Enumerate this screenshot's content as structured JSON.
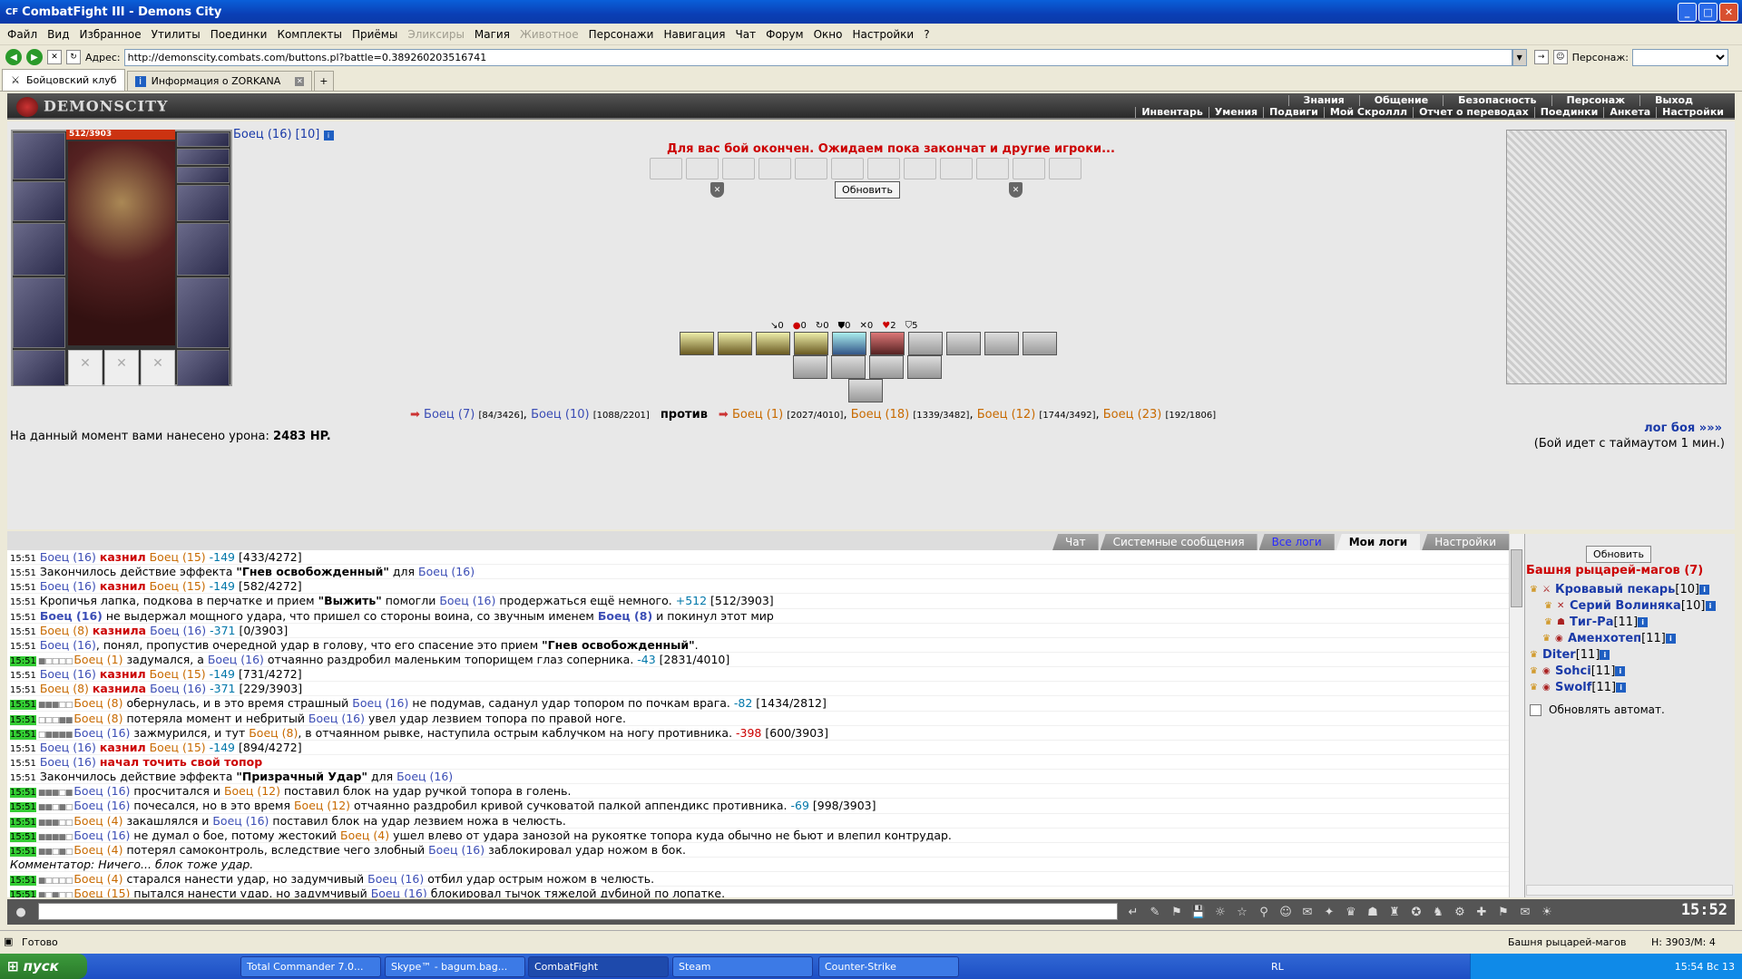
{
  "window": {
    "title": "CombatFight III - Demons City",
    "logo": "CF"
  },
  "menu": [
    {
      "label": "Файл",
      "enabled": true
    },
    {
      "label": "Вид",
      "enabled": true
    },
    {
      "label": "Избранное",
      "enabled": true
    },
    {
      "label": "Утилиты",
      "enabled": true
    },
    {
      "label": "Поединки",
      "enabled": true
    },
    {
      "label": "Комплекты",
      "enabled": true
    },
    {
      "label": "Приёмы",
      "enabled": true
    },
    {
      "label": "Эликсиры",
      "enabled": false
    },
    {
      "label": "Магия",
      "enabled": true
    },
    {
      "label": "Животное",
      "enabled": false
    },
    {
      "label": "Персонажи",
      "enabled": true
    },
    {
      "label": "Навигация",
      "enabled": true
    },
    {
      "label": "Чат",
      "enabled": true
    },
    {
      "label": "Форум",
      "enabled": true
    },
    {
      "label": "Окно",
      "enabled": true
    },
    {
      "label": "Настройки",
      "enabled": true
    },
    {
      "label": "?",
      "enabled": true
    }
  ],
  "address": {
    "label": "Адрес:",
    "url": "http://demonscity.combats.com/buttons.pl?battle=0.389260203516741",
    "persona_label": "Персонаж:"
  },
  "browser_tabs": [
    {
      "label": "Бойцовский клуб",
      "active": true
    },
    {
      "label": "Информация о ZORKANA",
      "active": false
    }
  ],
  "game": {
    "logo": "DEMONSCITY",
    "nav_top": [
      "Знания",
      "Общение",
      "Безопасность",
      "Персонаж",
      "Выход"
    ],
    "nav_bottom": [
      "Инвентарь",
      "Умения",
      "Подвиги",
      "Мой Скроллл",
      "Отчет о переводах",
      "Поединки",
      "Анкета",
      "Настройки"
    ],
    "hp": "512/3903",
    "player_name": "Боец (16) [10]",
    "status_message": "Для вас бой окончен. Ожидаем пока закончат и другие игроки...",
    "refresh_label": "Обновить",
    "counters": [
      "0",
      "0",
      "0",
      "0",
      "0",
      "2",
      "5"
    ],
    "team1": [
      {
        "name": "Боец (7)",
        "hp": "[84/3426]"
      },
      {
        "name": "Боец (10)",
        "hp": "[1088/2201]"
      }
    ],
    "vs": "против",
    "team2": [
      {
        "name": "Боец (1)",
        "hp": "[2027/4010]"
      },
      {
        "name": "Боец (18)",
        "hp": "[1339/3482]"
      },
      {
        "name": "Боец (12)",
        "hp": "[1744/3492]"
      },
      {
        "name": "Боец (23)",
        "hp": "[192/1806]"
      }
    ],
    "damage_label": "На данный момент вами нанесено урона:",
    "damage_value": "2483 HP.",
    "log_link": "лог боя »»»",
    "timeout": "(Бой идет с таймаутом 1 мин.)"
  },
  "log_tabs": [
    "Чат",
    "Системные сообщения",
    "Все логи",
    "Мои логи",
    "Настройки"
  ],
  "log": [
    {
      "time": "15:51",
      "g": false,
      "html": "<span class='link-blue'>Боец (16)</span> <span class='red'>казнил</span> <span class='link-orange'>Боец (15)</span> <span class='neg'>-149</span> [433/4272]"
    },
    {
      "time": "15:51",
      "g": false,
      "html": "Закончилось действие эффекта <b>\"Гнев освобожденный\"</b> для <span class='link-blue'>Боец (16)</span>"
    },
    {
      "time": "15:51",
      "g": false,
      "html": "<span class='link-blue'>Боец (16)</span> <span class='red'>казнил</span> <span class='link-orange'>Боец (15)</span> <span class='neg'>-149</span> [582/4272]"
    },
    {
      "time": "15:51",
      "g": false,
      "html": "Кропичья лапка, подкова в перчатке и прием <b>\"Выжить\"</b> помогли <span class='link-blue'>Боец (16)</span> продержаться ещё немного. <span class='neg'>+512</span> [512/3903]"
    },
    {
      "time": "15:51",
      "g": false,
      "html": "<b class='link-blue'>Боец (16)</b> не выдержал мощного удара, что пришел со стороны воина, со звучным именем <b class='link-blue'>Боец (8)</b> и покинул этот мир"
    },
    {
      "time": "15:51",
      "g": false,
      "html": "<span class='link-orange'>Боец (8)</span> <span class='red'>казнила</span> <span class='link-blue'>Боец (16)</span> <span class='neg'>-371</span> [0/3903]"
    },
    {
      "time": "15:51",
      "g": false,
      "html": "<span class='link-blue'>Боец (16)</span>, понял, пропустив очередной удар в голову, что его спасение это прием <b>\"Гнев освобожденный\"</b>."
    },
    {
      "time": "15:51",
      "g": true,
      "box": "■□□□□",
      "html": "<span class='link-orange'>Боец (1)</span> задумался, а <span class='link-blue'>Боец (16)</span> отчаянно раздробил маленьким топорищем глаз соперника. <span class='neg'>-43</span> [2831/4010]"
    },
    {
      "time": "15:51",
      "g": false,
      "html": "<span class='link-blue'>Боец (16)</span> <span class='red'>казнил</span> <span class='link-orange'>Боец (15)</span> <span class='neg'>-149</span> [731/4272]"
    },
    {
      "time": "15:51",
      "g": false,
      "html": "<span class='link-orange'>Боец (8)</span> <span class='red'>казнила</span> <span class='link-blue'>Боец (16)</span> <span class='neg'>-371</span> [229/3903]"
    },
    {
      "time": "15:51",
      "g": true,
      "box": "■■■□□",
      "html": "<span class='link-orange'>Боец (8)</span> обернулась, и в это время страшный <span class='link-blue'>Боец (16)</span> не подумав, саданул удар топором по почкам врага. <span class='neg'>-82</span> [1434/2812]"
    },
    {
      "time": "15:51",
      "g": true,
      "box": "□□□■■",
      "html": "<span class='link-orange'>Боец (8)</span> потеряла момент и небритый <span class='link-blue'>Боец (16)</span> увел удар лезвием топора по правой ноге."
    },
    {
      "time": "15:51",
      "g": true,
      "box": "□■■■■",
      "html": "<span class='link-blue'>Боец (16)</span> зажмурился, и тут <span class='link-orange'>Боец (8)</span>, в отчаянном рывке, наступила острым каблучком на ногу противника. <span class='hred'>-398</span> [600/3903]"
    },
    {
      "time": "15:51",
      "g": false,
      "html": "<span class='link-blue'>Боец (16)</span> <span class='red'>казнил</span> <span class='link-orange'>Боец (15)</span> <span class='neg'>-149</span> [894/4272]"
    },
    {
      "time": "15:51",
      "g": false,
      "html": "<span class='link-blue'>Боец (16)</span> <span class='red'>начал точить свой топор</span>"
    },
    {
      "time": "15:51",
      "g": false,
      "html": "Закончилось действие эффекта <b>\"Призрачный Удар\"</b> для <span class='link-blue'>Боец (16)</span>"
    },
    {
      "time": "15:51",
      "g": true,
      "box": "■■■□■",
      "html": "<span class='link-blue'>Боец (16)</span> просчитался и <span class='link-orange'>Боец (12)</span> поставил блок на удар ручкой топора в голень."
    },
    {
      "time": "15:51",
      "g": true,
      "box": "■■□■□",
      "html": "<span class='link-blue'>Боец (16)</span> почесался, но в это время <span class='link-orange'>Боец (12)</span> отчаянно раздробил кривой сучковатой палкой аппендикс противника. <span class='neg'>-69</span> [998/3903]"
    },
    {
      "time": "15:51",
      "g": true,
      "box": "■■■□□",
      "html": "<span class='link-orange'>Боец (4)</span> закашлялся и <span class='link-blue'>Боец (16)</span> поставил блок на удар лезвием ножа в челюсть."
    },
    {
      "time": "15:51",
      "g": true,
      "box": "■■■■□",
      "html": "<span class='link-blue'>Боец (16)</span> не думал о бое, потому жестокий <span class='link-orange'>Боец (4)</span> ушел влево от удара занозой на рукоятке топора куда обычно не бьют и влепил контрудар."
    },
    {
      "time": "15:51",
      "g": true,
      "box": "■■□■□",
      "html": "<span class='link-orange'>Боец (4)</span> потерял самоконтроль, вследствие чего злобный <span class='link-blue'>Боец (16)</span> заблокировал удар ножом в бок."
    },
    {
      "time": "",
      "g": false,
      "html": "<span class='it'>Комментатор: Ничего... блок тоже удар.</span>"
    },
    {
      "time": "15:51",
      "g": true,
      "box": "■□□□□",
      "html": "<span class='link-orange'>Боец (4)</span> старался нанести удар, но задумчивый <span class='link-blue'>Боец (16)</span> отбил удар острым ножом в челюсть."
    },
    {
      "time": "15:51",
      "g": true,
      "box": "■□■□□",
      "html": "<span class='link-orange'>Боец (15)</span> пытался нанести удар, но задумчивый <span class='link-blue'>Боец (16)</span> блокировал тычок тяжелой дубиной по лопатке."
    }
  ],
  "room": {
    "refresh_label": "Обновить",
    "title": "Башня рыцарей-магов (7)",
    "members": [
      {
        "name": "Кровавый пекарь",
        "level": "[10]"
      },
      {
        "name": "Серий Волиняка",
        "level": "[10]"
      },
      {
        "name": "Тиг-Ра",
        "level": "[11]"
      },
      {
        "name": "Аменхотеп",
        "level": "[11]"
      },
      {
        "name": "Diter",
        "level": "[11]"
      },
      {
        "name": "Sohci",
        "level": "[11]"
      },
      {
        "name": "Swolf",
        "level": "[11]"
      }
    ],
    "auto_refresh_label": "Обновлять автомат."
  },
  "chat": {
    "clock": "15:52"
  },
  "status": {
    "text": "Готово",
    "room": "Башня рыцарей-магов",
    "hp": "H: 3903/M: 4"
  },
  "taskbar": {
    "start": "пуск",
    "buttons": [
      "Total Commander 7.0...",
      "Skype™ - bagum.bag...",
      "CombatFight",
      "Steam",
      "Counter-Strike"
    ],
    "lang": "RL",
    "clock": "15:54 Вс 13"
  }
}
